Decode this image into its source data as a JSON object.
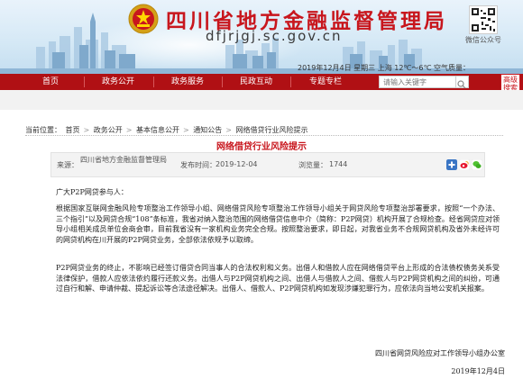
{
  "header": {
    "bureau_title": "四川省地方金融监督管理局",
    "site_url": "dfjrjgj.sc.gov.cn",
    "qr_label": "微信公众号",
    "weather": "2019年12月4日 星期三  上海  12℃～6℃  空气质量："
  },
  "nav": {
    "items": [
      "首页",
      "政务公开",
      "政务服务",
      "民政互动",
      "专题专栏"
    ],
    "search_placeholder": "请输入关键字",
    "advanced_search": "高级搜索"
  },
  "breadcrumb": {
    "prefix": "当前位置：",
    "items": [
      "首页",
      "政务公开",
      "基本信息公开",
      "通知公告",
      "网络借贷行业风险提示"
    ]
  },
  "article": {
    "title": "网络借贷行业风险提示",
    "source_label": "来源：",
    "source_value": "四川省地方金融监督管理局",
    "date_label": "发布时间：",
    "date_value": "2019-12-04",
    "views_label": "浏览量：",
    "views_value": "1744",
    "greeting": "广大P2P网贷参与人：",
    "para1": "根据国家互联网金融风险专项整治工作领导小组、网络借贷风险专项整治工作领导小组关于网贷风险专项整治部署要求，按照“一个办法、三个指引”以及网贷合规“108”条标准，我省对纳入整治范围的网络借贷信息中介（简称：P2P网贷）机构开展了合规检查。经省网贷应对领导小组相关成员单位会商会审，目前我省没有一家机构业务完全合规。按照整治要求，即日起，对我省业务不合规网贷机构及省外未经许可的网贷机构在川开展的P2P网贷业务，全部依法依规予以取缔。",
    "para2": "P2P网贷业务的终止，不影响已经签订借贷合同当事人的合法权利和义务。出借人和借款人应在网络借贷平台上形成的合法债权债务关系受法律保护，借款人应依法依约履行还款义务。出借人与P2P网贷机构之间、出借人与借款人之间、借款人与P2P网贷机构之间的纠纷，可通过自行和解、申请仲裁、提起诉讼等合法途径解决。出借人、借款人、P2P网贷机构如发现涉嫌犯罪行为，应依法向当地公安机关报案。",
    "signature": "四川省网贷风险应对工作领导小组办公室",
    "sign_date": "2019年12月4日"
  },
  "colors": {
    "brand_red": "#c8161d",
    "nav_red": "#b01014"
  },
  "icons": [
    "emblem-icon",
    "qr-code-icon",
    "search-icon",
    "plus-share-icon",
    "weibo-icon",
    "wechat-icon"
  ]
}
